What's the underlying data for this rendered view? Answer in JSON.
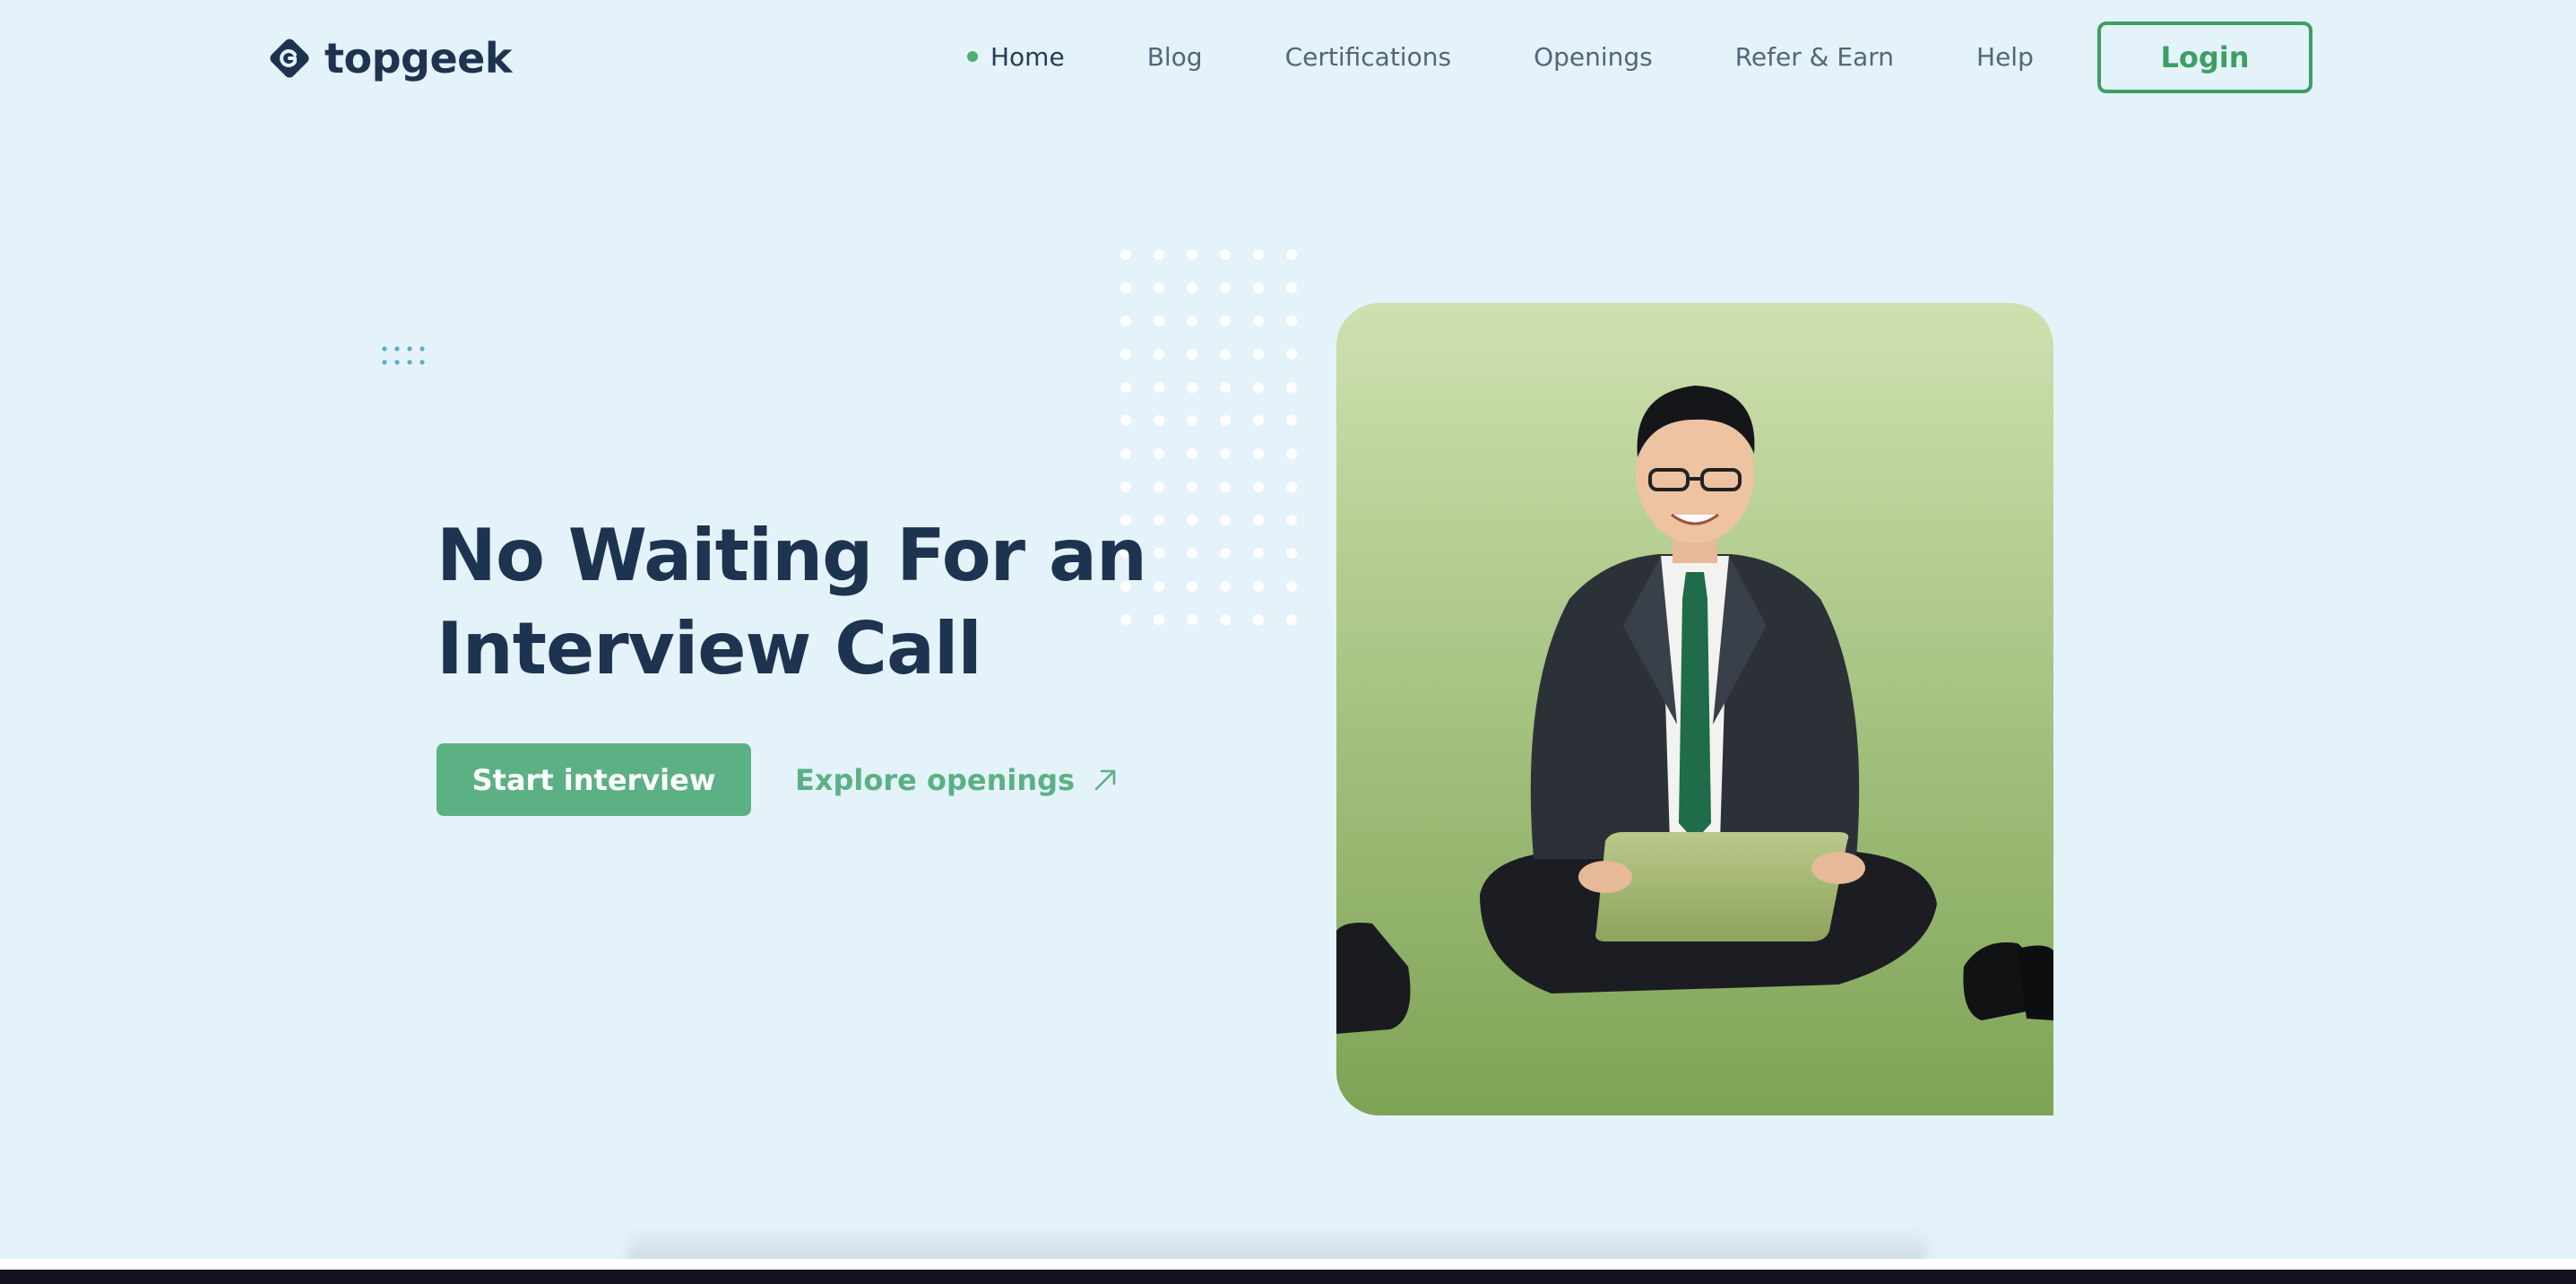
{
  "brand": {
    "name": "topgeek",
    "logo_icon": "diamond-g-logo-icon"
  },
  "nav": {
    "items": [
      {
        "label": "Home",
        "active": true
      },
      {
        "label": "Blog",
        "active": false
      },
      {
        "label": "Certifications",
        "active": false
      },
      {
        "label": "Openings",
        "active": false
      },
      {
        "label": "Refer & Earn",
        "active": false
      },
      {
        "label": "Help",
        "active": false
      }
    ],
    "login_label": "Login"
  },
  "hero": {
    "headline_line1": "No Waiting For an",
    "headline_line2": "Interview Call",
    "primary_cta": "Start interview",
    "secondary_cta": "Explore openings",
    "secondary_cta_icon": "arrow-up-right-icon",
    "image_subject": "person-sitting-on-grass-with-laptop"
  },
  "colors": {
    "background": "#e3f3f9",
    "heading": "#1e3350",
    "accent_green": "#5cb184",
    "login_border": "#3f9e63"
  }
}
